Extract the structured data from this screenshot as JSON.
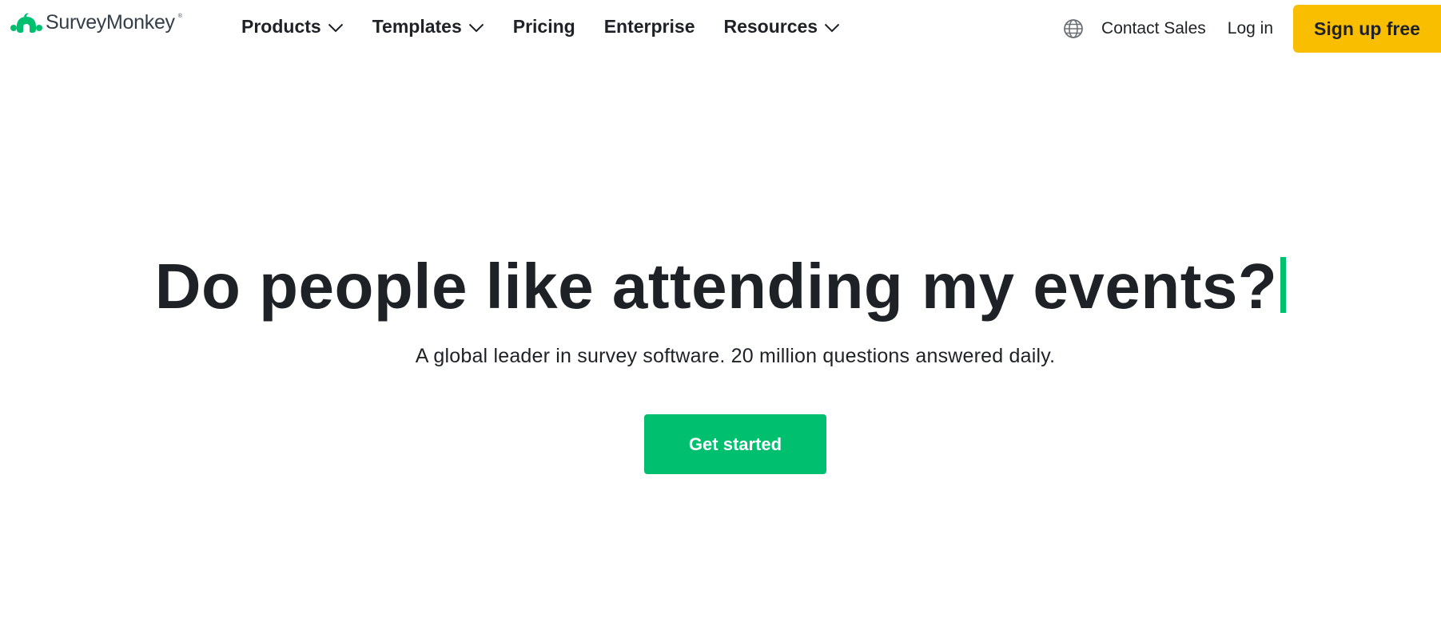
{
  "brand": {
    "name": "SurveyMonkey",
    "registered_mark": "®",
    "logo_icon": "monkey-logo-icon",
    "logo_color": "#00bf6f"
  },
  "nav": {
    "items": [
      {
        "label": "Products",
        "has_dropdown": true,
        "icon": "chevron-down-icon"
      },
      {
        "label": "Templates",
        "has_dropdown": true,
        "icon": "chevron-down-icon"
      },
      {
        "label": "Pricing",
        "has_dropdown": false
      },
      {
        "label": "Enterprise",
        "has_dropdown": false
      },
      {
        "label": "Resources",
        "has_dropdown": true,
        "icon": "chevron-down-icon"
      }
    ]
  },
  "header_actions": {
    "language_icon": "globe-icon",
    "contact_sales_label": "Contact Sales",
    "login_label": "Log in",
    "signup_label": "Sign up free"
  },
  "hero": {
    "headline": "Do people like attending my events?",
    "subheadline": "A global leader in survey software. 20 million questions answered daily.",
    "cta_label": "Get started"
  },
  "colors": {
    "accent_green": "#00bf6f",
    "signup_yellow": "#f9be00",
    "text_dark": "#1e2126",
    "background": "#ffffff"
  }
}
